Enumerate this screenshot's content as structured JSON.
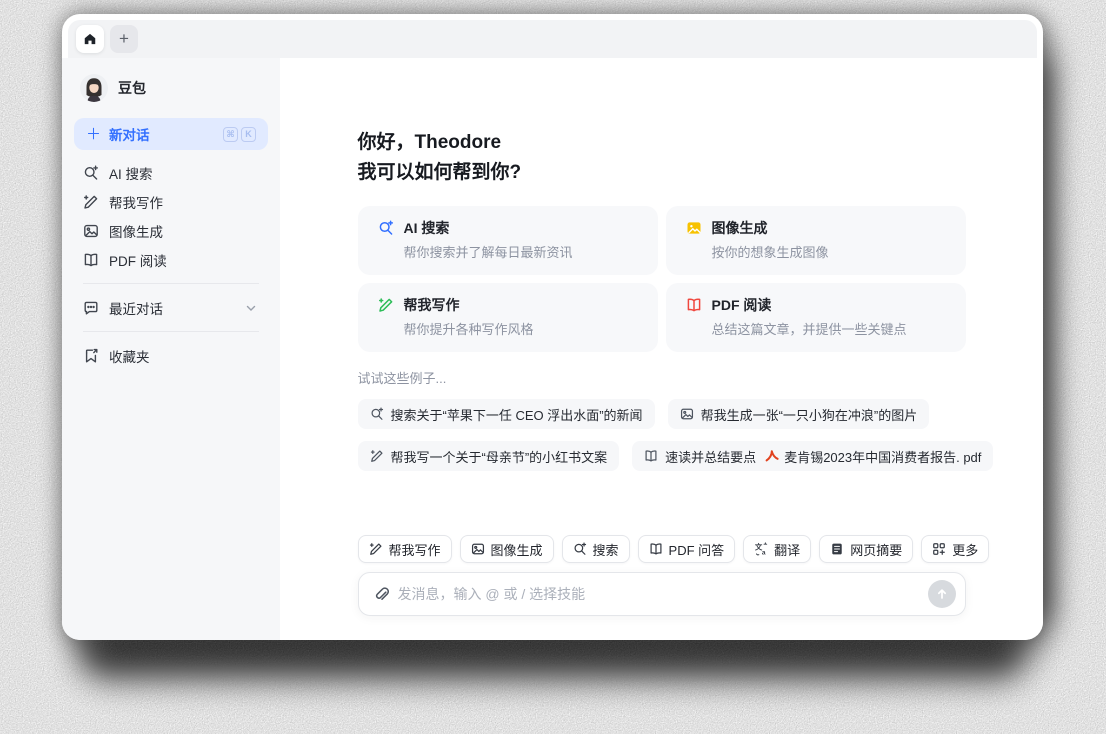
{
  "app": {
    "name": "豆包"
  },
  "tabbar": {
    "new_tab_label": "+"
  },
  "sidebar": {
    "profile_name": "豆包",
    "new_chat": {
      "label": "新对话",
      "kbd1": "⌘",
      "kbd2": "K"
    },
    "items": [
      {
        "label": "AI 搜索",
        "icon": "ai-search-icon"
      },
      {
        "label": "帮我写作",
        "icon": "write-icon"
      },
      {
        "label": "图像生成",
        "icon": "image-gen-icon"
      },
      {
        "label": "PDF 阅读",
        "icon": "pdf-read-icon"
      }
    ],
    "recent_label": "最近对话",
    "favorites_label": "收藏夹"
  },
  "main": {
    "greeting_line1": "你好，Theodore",
    "greeting_line2": "我可以如何帮到你?",
    "cards": [
      {
        "title": "AI 搜索",
        "desc": "帮你搜索并了解每日最新资讯",
        "icon": "ai-search-icon",
        "accent": "#3370ff"
      },
      {
        "title": "图像生成",
        "desc": "按你的想象生成图像",
        "icon": "image-gen-icon",
        "accent": "#f7c200"
      },
      {
        "title": "帮我写作",
        "desc": "帮你提升各种写作风格",
        "icon": "write-icon",
        "accent": "#2ebd59"
      },
      {
        "title": "PDF 阅读",
        "desc": "总结这篇文章，并提供一些关键点",
        "icon": "pdf-read-icon",
        "accent": "#f0473e"
      }
    ],
    "examples_label": "试试这些例子...",
    "example_chips": [
      {
        "icon": "search-icon",
        "text": "搜索关于“苹果下一任 CEO 浮出水面”的新闻"
      },
      {
        "icon": "image-icon",
        "text": "帮我生成一张“一只小狗在冲浪”的图片"
      },
      {
        "icon": "write-icon",
        "text": "帮我写一个关于“母亲节”的小红书文案"
      },
      {
        "icon": "book-icon",
        "text": "速读并总结要点",
        "attachment": "麦肯锡2023年中国消费者报告. pdf",
        "attachment_icon": "pdf-file-icon"
      }
    ]
  },
  "composer": {
    "skills": [
      {
        "label": "帮我写作",
        "icon": "write-icon"
      },
      {
        "label": "图像生成",
        "icon": "image-icon"
      },
      {
        "label": "搜索",
        "icon": "search-icon"
      },
      {
        "label": "PDF 问答",
        "icon": "book-icon"
      },
      {
        "label": "翻译",
        "icon": "translate-icon"
      },
      {
        "label": "网页摘要",
        "icon": "webpage-icon"
      },
      {
        "label": "更多",
        "icon": "more-grid-icon"
      }
    ],
    "input_placeholder": "发消息，输入 @ 或 / 选择技能"
  },
  "colors": {
    "accent_blue": "#3370ff",
    "write_green": "#2ebd59",
    "image_yellow": "#f7c200",
    "pdf_red": "#f0473e",
    "new_chat_bg": "#e1eaff",
    "sidebar_bg": "#f6f7f9",
    "card_bg": "#f7f8fa",
    "border": "#e4e6ea",
    "text_primary": "#21242b",
    "text_secondary": "#8d93a1"
  }
}
